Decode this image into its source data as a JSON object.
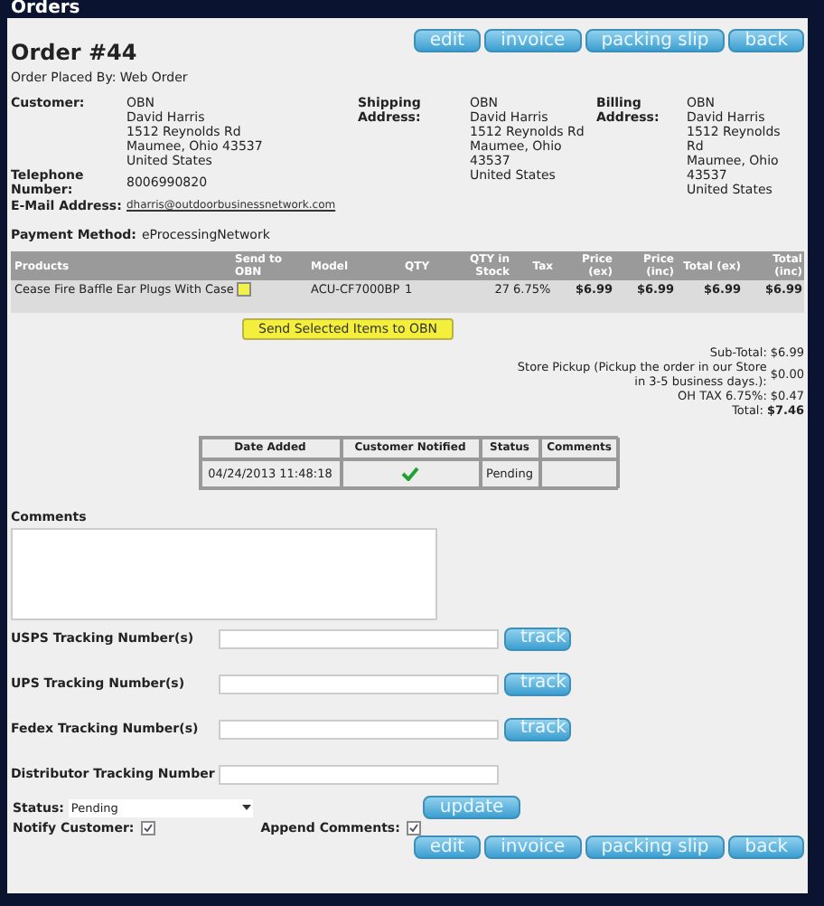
{
  "page_title": "Orders",
  "order_title": "Order #44",
  "placed_by": "Order Placed By: Web Order",
  "top_buttons": [
    "edit",
    "invoice",
    "packing slip",
    "back"
  ],
  "customer": {
    "label": "Customer:",
    "lines": [
      "OBN",
      "David Harris",
      "1512 Reynolds Rd",
      "Maumee, Ohio 43537",
      "United States"
    ]
  },
  "shipping": {
    "label": "Shipping Address:",
    "lines": [
      "OBN",
      "David Harris",
      "1512 Reynolds Rd",
      "Maumee, Ohio 43537",
      "United States"
    ]
  },
  "billing": {
    "label": "Billing Address:",
    "lines": [
      "OBN",
      "David Harris",
      "1512 Reynolds Rd",
      "Maumee, Ohio 43537",
      "United States"
    ]
  },
  "telephone": {
    "label": "Telephone Number:",
    "value": "8006990820"
  },
  "email": {
    "label": "E-Mail Address:",
    "value": "dharris@outdoorbusinessnetwork.com"
  },
  "payment": {
    "label": "Payment Method:",
    "value": "eProcessingNetwork"
  },
  "products": {
    "columns": [
      "Products",
      "Send to OBN",
      "Model",
      "QTY",
      "QTY in Stock",
      "Tax",
      "Price (ex)",
      "Price (inc)",
      "Total (ex)",
      "Total (inc)"
    ],
    "rows": [
      {
        "name": "Cease Fire Baffle Ear Plugs With Case",
        "send_checked": false,
        "model": "ACU-CF7000BP",
        "qty": "1",
        "stock": "27",
        "tax": "6.75%",
        "price_ex": "$6.99",
        "price_inc": "$6.99",
        "total_ex": "$6.99",
        "total_inc": "$6.99"
      }
    ]
  },
  "send_button": "Send Selected Items to OBN",
  "totals": [
    {
      "label": "Sub-Total:",
      "value": "$6.99",
      "bold": false
    },
    {
      "label": "Store Pickup (Pickup the order in our Store in 3-5 business days.):",
      "value": "$0.00",
      "bold": false
    },
    {
      "label": "OH TAX 6.75%:",
      "value": "$0.47",
      "bold": false
    },
    {
      "label": "Total:",
      "value": "$7.46",
      "bold": true
    }
  ],
  "history": {
    "columns": [
      "Date Added",
      "Customer Notified",
      "Status",
      "Comments"
    ],
    "rows": [
      {
        "date": "04/24/2013 11:48:18",
        "notified": true,
        "status": "Pending"
      }
    ]
  },
  "comments_label": "Comments",
  "tracking": [
    {
      "label": "USPS Tracking Number(s)",
      "button": "track"
    },
    {
      "label": "UPS Tracking Number(s)",
      "button": "track"
    },
    {
      "label": "Fedex Tracking Number(s)",
      "button": "track"
    },
    {
      "label": "Distributor Tracking Number"
    }
  ],
  "status": {
    "label": "Status:",
    "value": "Pending"
  },
  "update_button": "update",
  "notify": {
    "label": "Notify Customer:",
    "checked": true
  },
  "append": {
    "label": "Append Comments:",
    "checked": true
  },
  "bottom_buttons": [
    "edit",
    "invoice",
    "packing slip",
    "back"
  ]
}
